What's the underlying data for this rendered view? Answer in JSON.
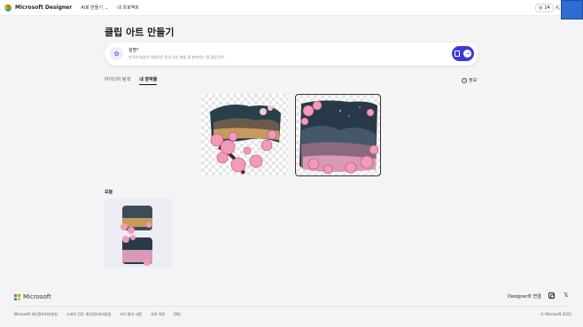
{
  "header": {
    "brand": "Microsoft Designer",
    "nav_create": "AI로 만들기",
    "nav_projects": "내 프로젝트",
    "credits": "14",
    "icons": [
      "designer-logo-icon",
      "coin-icon",
      "share-icon"
    ]
  },
  "page": {
    "title": "클립 아트 만들기"
  },
  "prompt": {
    "label": "설명*",
    "placeholder": "한국의 벚꽃이 아름다운 풍경 추상 화법 을 표현하는 협 클립 아트",
    "icons": [
      "clipart-icon",
      "image-icon",
      "arrow-right-icon"
    ]
  },
  "tabs": [
    {
      "label": "아이디어 탐색",
      "active": false
    },
    {
      "label": "내 창작물",
      "active": true
    }
  ],
  "info_label": "정보",
  "results": [
    {
      "description": "cherry blossom landscape clip art 1"
    },
    {
      "description": "cherry blossom landscape clip art 2"
    }
  ],
  "history": {
    "section_label": "오늘"
  },
  "footer": {
    "brand": "Microsoft",
    "connect_label": "Designer와 연결",
    "links": [
      "Microsoft 개인정보처리방침",
      "소비자 건강 개인정보처리방침",
      "지식 통치 사항",
      "사용 약관",
      "FAQ"
    ],
    "copyright": "© Microsoft 2023"
  },
  "colors": {
    "accent": "#3b3bd6",
    "background": "#f4f4f7",
    "blossom": "#f19bb8"
  }
}
